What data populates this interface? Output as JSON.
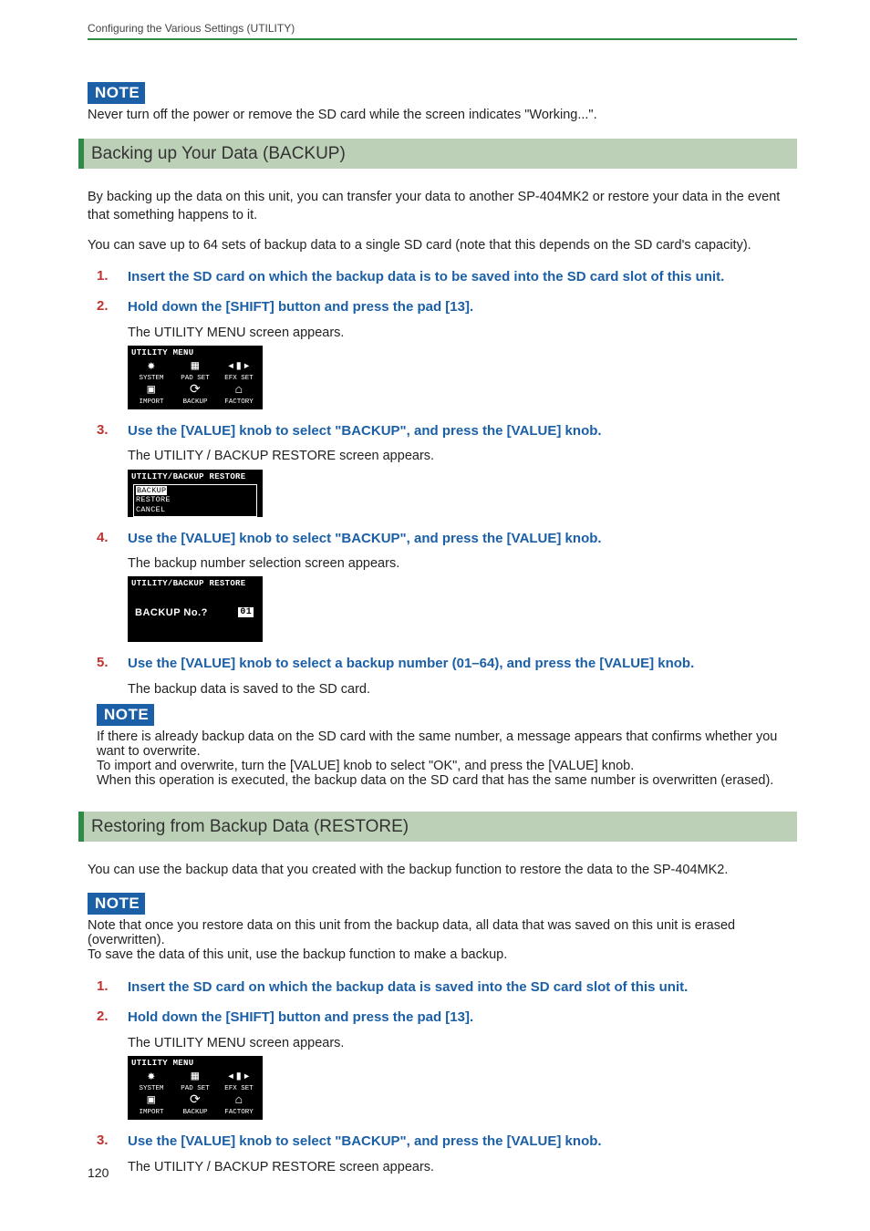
{
  "header": "Configuring the Various Settings (UTILITY)",
  "note_label": "NOTE",
  "intro_note": "Never turn off the power or remove the SD card while the screen indicates \"Working...\".",
  "backup": {
    "heading": "Backing up Your Data (BACKUP)",
    "para1": "By backing up the data on this unit, you can transfer your data to another SP-404MK2 or restore your data in the event that something happens to it.",
    "para2": "You can save up to 64 sets of backup data to a single SD card (note that this depends on the SD card's capacity).",
    "steps": [
      {
        "n": "1.",
        "title": "Insert the SD card on which the backup data is to be saved into the SD card slot of this unit."
      },
      {
        "n": "2.",
        "title": "Hold down the [SHIFT] button and press the pad [13].",
        "body": "The UTILITY MENU screen appears.",
        "lcd": "menu"
      },
      {
        "n": "3.",
        "title": "Use the [VALUE] knob to select \"BACKUP\", and press the [VALUE] knob.",
        "body": "The UTILITY / BACKUP RESTORE screen appears.",
        "lcd": "restorelist"
      },
      {
        "n": "4.",
        "title": "Use the [VALUE] knob to select \"BACKUP\", and press the [VALUE] knob.",
        "body": "The backup number selection screen appears.",
        "lcd": "numsel"
      },
      {
        "n": "5.",
        "title": "Use the [VALUE] knob to select a backup number (01–64), and press the [VALUE] knob.",
        "body": "The backup data is saved to the SD card."
      }
    ],
    "after_note_lines": [
      "If there is already backup data on the SD card with the same number, a message appears that confirms whether you want to overwrite.",
      "To import and overwrite, turn the [VALUE] knob to select \"OK\", and press the [VALUE] knob.",
      "When this operation is executed, the backup data on the SD card that has the same number is overwritten (erased)."
    ]
  },
  "lcd_menu": {
    "title": "UTILITY MENU",
    "row1": [
      "SYSTEM",
      "PAD SET",
      "EFX SET"
    ],
    "row2": [
      "IMPORT",
      "BACKUP",
      "FACTORY"
    ]
  },
  "lcd_restore": {
    "title": "UTILITY/BACKUP RESTORE",
    "items": [
      "BACKUP",
      "RESTORE",
      "CANCEL"
    ]
  },
  "lcd_num": {
    "title": "UTILITY/BACKUP RESTORE",
    "label": "BACKUP No.?",
    "value": "01"
  },
  "restore": {
    "heading": "Restoring from Backup Data (RESTORE)",
    "para1": "You can use the backup data that you created with the backup function to restore the data to the SP-404MK2.",
    "note_lines": [
      "Note that once you restore data on this unit from the backup data, all data that was saved on this unit is erased (overwritten).",
      "To save the data of this unit, use the backup function to make a backup."
    ],
    "steps": [
      {
        "n": "1.",
        "title": "Insert the SD card on which the backup data is saved into the SD card slot of this unit."
      },
      {
        "n": "2.",
        "title": "Hold down the [SHIFT] button and press the pad [13].",
        "body": "The UTILITY MENU screen appears.",
        "lcd": "menu"
      },
      {
        "n": "3.",
        "title": "Use the [VALUE] knob to select \"BACKUP\", and press the [VALUE] knob.",
        "body": "The UTILITY / BACKUP RESTORE screen appears."
      }
    ]
  },
  "page_number": "120"
}
